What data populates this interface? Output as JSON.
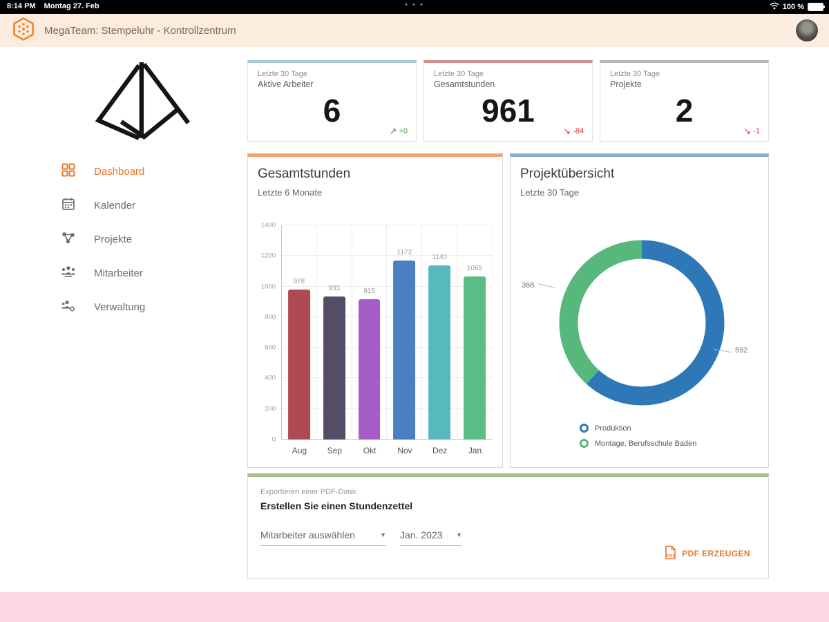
{
  "status_bar": {
    "time": "8:14 PM",
    "date": "Montag 27. Feb",
    "handle_dots": "• • •",
    "battery_percent": "100 %"
  },
  "header": {
    "title": "MegaTeam: Stempeluhr - Kontrollzentrum"
  },
  "sidebar": {
    "items": [
      {
        "label": "Dashboard",
        "icon": "dashboard-grid-icon",
        "active": true
      },
      {
        "label": "Kalender",
        "icon": "calendar-icon",
        "active": false
      },
      {
        "label": "Projekte",
        "icon": "projects-network-icon",
        "active": false
      },
      {
        "label": "Mitarbeiter",
        "icon": "employees-group-icon",
        "active": false
      },
      {
        "label": "Verwaltung",
        "icon": "administration-icon",
        "active": false
      }
    ]
  },
  "stat_cards": [
    {
      "period": "Letzte 30 Tage",
      "label": "Aktive Arbeiter",
      "value": "6",
      "trend": "+0",
      "trend_direction": "up",
      "accent": "#a9ccd6"
    },
    {
      "period": "Letzte 30 Tage",
      "label": "Gesamtstunden",
      "value": "961",
      "trend": "-84",
      "trend_direction": "down",
      "accent": "#d3908f"
    },
    {
      "period": "Letzte 30 Tage",
      "label": "Projekte",
      "value": "2",
      "trend": "-1",
      "trend_direction": "down",
      "accent": "#b7b7b7"
    }
  ],
  "chart_data": [
    {
      "type": "bar",
      "title": "Gesamtstunden",
      "subtitle": "Letzte 6 Monate",
      "categories": [
        "Aug",
        "Sep",
        "Okt",
        "Nov",
        "Dez",
        "Jan"
      ],
      "values": [
        978,
        933,
        915,
        1172,
        1140,
        1065
      ],
      "bar_colors": [
        "#ae4a54",
        "#554d68",
        "#a65cc5",
        "#4a7fc1",
        "#57b9bd",
        "#5abd85"
      ],
      "ylim": [
        0,
        1400
      ],
      "ytick_step": 200,
      "grid": true,
      "accent": "#f0a470"
    },
    {
      "type": "donut",
      "title": "Projektübersicht",
      "subtitle": "Letzte 30 Tage",
      "series": [
        {
          "name": "Produktion",
          "value": 592,
          "color": "#2e78b8"
        },
        {
          "name": "Montage, Berufsschule Baden",
          "value": 368,
          "color": "#57b87c"
        }
      ],
      "legend_position": "bottom",
      "accent": "#82b1d0"
    }
  ],
  "export_panel": {
    "subtitle": "Exportieren einer PDF-Datei",
    "title": "Erstellen Sie einen Stundenzettel",
    "employee_select": "Mitarbeiter auswählen",
    "month_select": "Jan. 2023",
    "button_label": "PDF ERZEUGEN",
    "accent": "#a9c087"
  }
}
